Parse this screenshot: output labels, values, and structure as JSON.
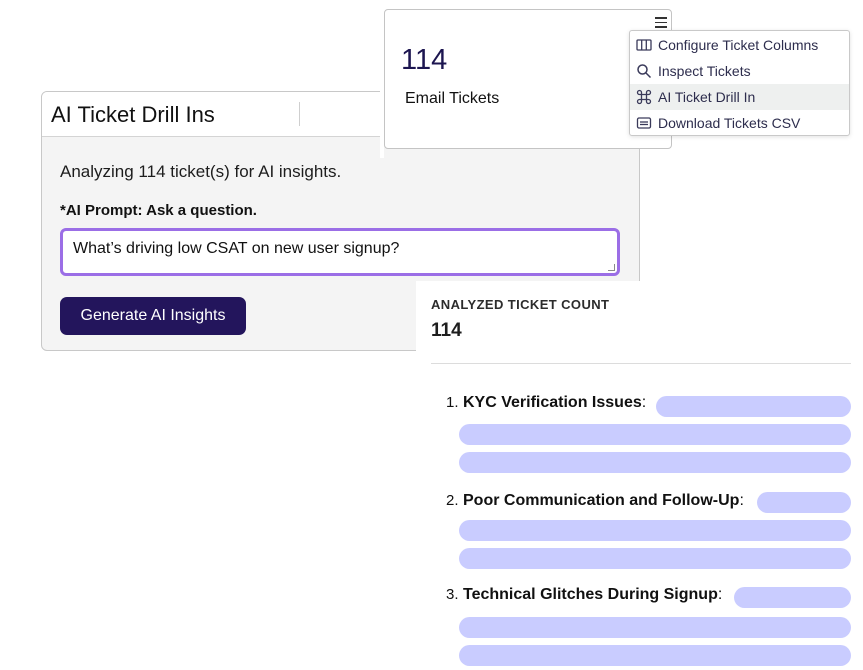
{
  "drill_panel": {
    "title": "AI Ticket Drill Ins",
    "analyzing_text": "Analyzing 114 ticket(s) for AI insights.",
    "prompt_label": "*AI Prompt: Ask a question.",
    "prompt_value": "What’s driving low CSAT on new user signup?",
    "generate_button": "Generate AI Insights"
  },
  "ticket_card": {
    "count": "114",
    "label": "Email Tickets",
    "menu_icon": "hamburger-icon"
  },
  "context_menu": {
    "items": [
      {
        "label": "Configure Ticket Columns",
        "icon": "columns-icon",
        "active": false
      },
      {
        "label": "Inspect Tickets",
        "icon": "search-icon",
        "active": false
      },
      {
        "label": "AI Ticket Drill In",
        "icon": "command-icon",
        "active": true
      },
      {
        "label": "Download Tickets CSV",
        "icon": "download-icon",
        "active": false
      }
    ]
  },
  "results": {
    "count_heading": "ANALYZED TICKET COUNT",
    "count_value": "114",
    "insights": [
      {
        "number": "1.",
        "title": "KYC Verification Issues",
        "suffix": ":"
      },
      {
        "number": "2.",
        "title": "Poor Communication and Follow-Up",
        "suffix": ":"
      },
      {
        "number": "3.",
        "title": "Technical Glitches During Signup",
        "suffix": ":"
      }
    ]
  },
  "colors": {
    "accent_button": "#23155c",
    "input_focus_border": "#9b6ee6",
    "skeleton": "#c9ccff",
    "count_text": "#1c1550"
  }
}
